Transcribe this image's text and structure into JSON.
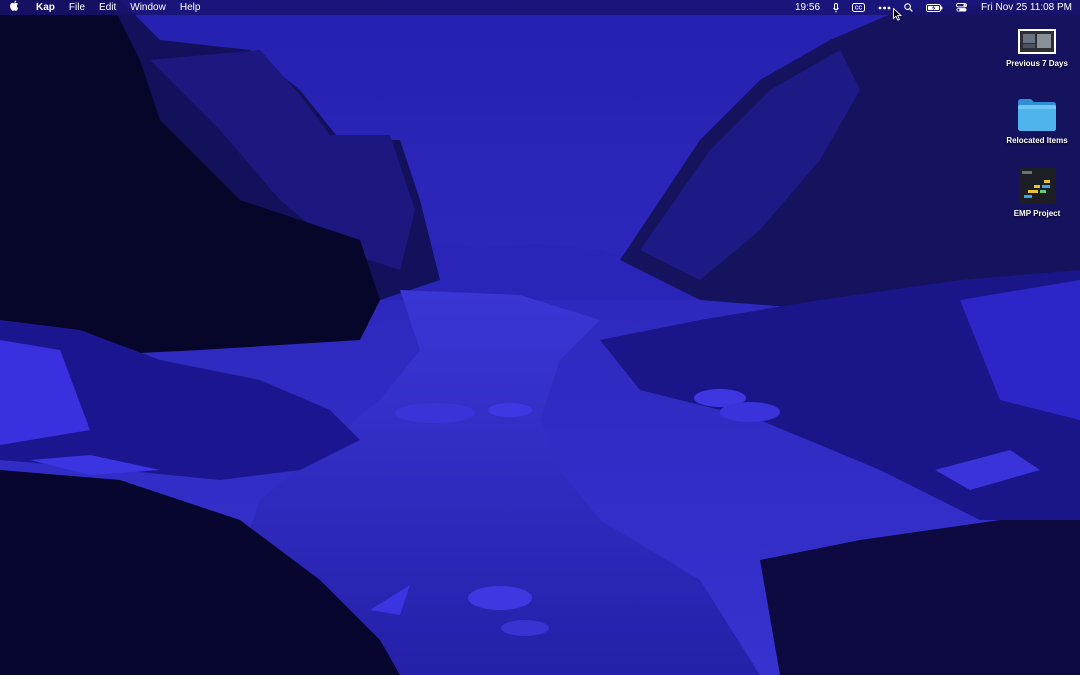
{
  "menubar": {
    "apple_icon": "apple-logo-icon",
    "app_name": "Kap",
    "menus": [
      "File",
      "Edit",
      "Window",
      "Help"
    ],
    "status": {
      "time_short": "19:56",
      "icons": [
        "microphone-icon",
        "cc-icon",
        "more-dots-icon",
        "search-icon",
        "battery-charging-icon",
        "control-center-icon"
      ],
      "clock": "Fri Nov 25  11:08 PM"
    }
  },
  "desktop": {
    "icons": [
      {
        "label": "Previous 7 Days",
        "kind": "screenshot-thumbnail-icon"
      },
      {
        "label": "Relocated Items",
        "kind": "folder-icon"
      },
      {
        "label": "EMP Project",
        "kind": "document-thumbnail-icon"
      }
    ]
  },
  "colors": {
    "sky": "#2c27b5",
    "water": "#2a25c0",
    "accent": "#4b3de8",
    "folder": "#3aa7e8",
    "menubar": "#18146e"
  }
}
